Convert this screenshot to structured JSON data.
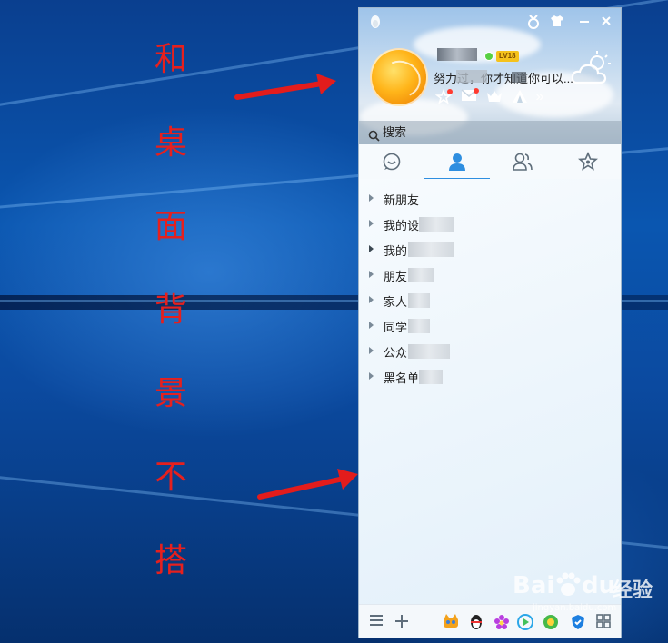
{
  "annotation": {
    "vertical_text": [
      "和",
      "桌",
      "面",
      "背",
      "景",
      "不",
      "搭"
    ],
    "color": "#e6201e"
  },
  "qq": {
    "level_badge": "LV18",
    "signature": "努力过，你才知道你可以...",
    "search_label": "搜索",
    "tabs": [
      "chat-tab",
      "contacts-tab",
      "groups-tab",
      "favorites-tab"
    ],
    "active_tab": 1,
    "groups": [
      {
        "label": "新朋友"
      },
      {
        "label": "我的设"
      },
      {
        "label": "我的"
      },
      {
        "label": "朋友"
      },
      {
        "label": "家人"
      },
      {
        "label": "同学"
      },
      {
        "label": "公众"
      },
      {
        "label": "黑名单"
      }
    ],
    "accent": "#2e8ee0"
  },
  "watermark": {
    "brand": "Bai",
    "brand_suffix": "du",
    "product": "经验",
    "url": "jingyan.baidu.com"
  }
}
